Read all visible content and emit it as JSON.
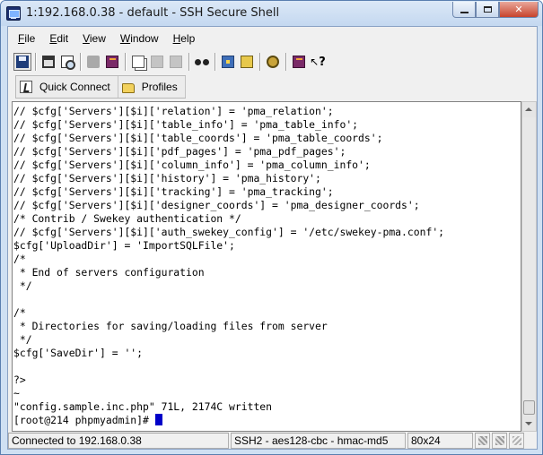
{
  "window": {
    "title": "1:192.168.0.38 - default - SSH Secure Shell",
    "close_glyph": "✕"
  },
  "menu": {
    "items": [
      {
        "accel": "F",
        "rest": "ile"
      },
      {
        "accel": "E",
        "rest": "dit"
      },
      {
        "accel": "V",
        "rest": "iew"
      },
      {
        "accel": "W",
        "rest": "indow"
      },
      {
        "accel": "H",
        "rest": "elp"
      }
    ]
  },
  "toolbar": {
    "icons": [
      "save-icon",
      "print-icon",
      "print-preview-icon",
      "disconnect-icon",
      "cut-icon",
      "copy-icon",
      "paste-icon",
      "paste-disabled-icon",
      "find-icon",
      "settings-icon",
      "profile-settings-icon",
      "key-icon",
      "help-book-icon",
      "whats-this-icon"
    ],
    "help_glyph": "?",
    "arrow_glyph": "↖"
  },
  "quickbar": {
    "quick_connect": "Quick Connect",
    "profiles": "Profiles"
  },
  "terminal": {
    "lines": [
      "// $cfg['Servers'][$i]['relation'] = 'pma_relation';",
      "// $cfg['Servers'][$i]['table_info'] = 'pma_table_info';",
      "// $cfg['Servers'][$i]['table_coords'] = 'pma_table_coords';",
      "// $cfg['Servers'][$i]['pdf_pages'] = 'pma_pdf_pages';",
      "// $cfg['Servers'][$i]['column_info'] = 'pma_column_info';",
      "// $cfg['Servers'][$i]['history'] = 'pma_history';",
      "// $cfg['Servers'][$i]['tracking'] = 'pma_tracking';",
      "// $cfg['Servers'][$i]['designer_coords'] = 'pma_designer_coords';",
      "/* Contrib / Swekey authentication */",
      "// $cfg['Servers'][$i]['auth_swekey_config'] = '/etc/swekey-pma.conf';",
      "$cfg['UploadDir'] = 'ImportSQLFile';",
      "/*",
      " * End of servers configuration",
      " */",
      "",
      "/*",
      " * Directories for saving/loading files from server",
      " */",
      "$cfg['SaveDir'] = '';",
      "",
      "?>",
      "~",
      "\"config.sample.inc.php\" 71L, 2174C written"
    ],
    "prompt": "[root@214 phpmyadmin]# "
  },
  "status": {
    "connection": "Connected to 192.168.0.38",
    "cipher": "SSH2 - aes128-cbc - hmac-md5",
    "size": "80x24"
  }
}
